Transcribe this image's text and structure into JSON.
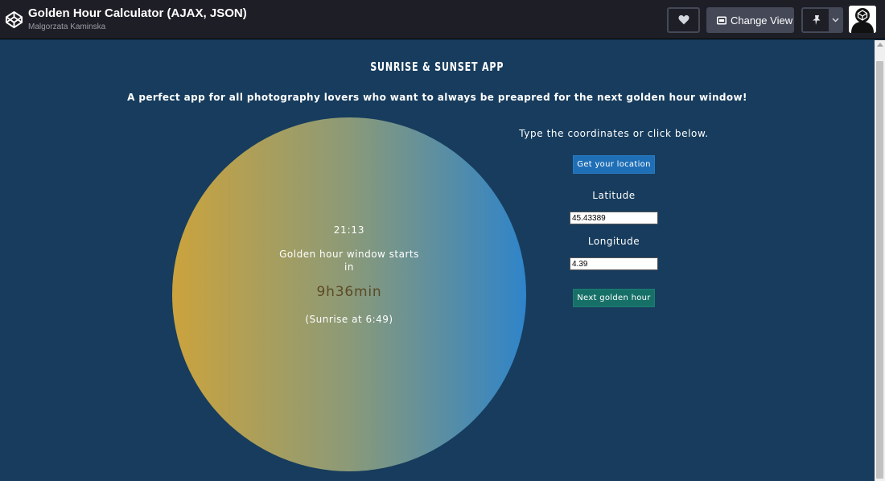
{
  "header": {
    "title": "Golden Hour Calculator (AJAX, JSON)",
    "author": "Malgorzata Kaminska",
    "change_view_label": "Change View"
  },
  "app": {
    "heading": "SUNRISE & SUNSET APP",
    "tagline": "A perfect app for all photography lovers who want to always be preapred for the next golden hour window!",
    "circle": {
      "time": "21:13",
      "label": "Golden hour window starts in",
      "countdown": "9h36min",
      "sunrise": "(Sunrise at 6:49)"
    },
    "form": {
      "instructions": "Type the coordinates or click below.",
      "location_button": "Get your location",
      "latitude_label": "Latitude",
      "latitude_value": "45.43389",
      "longitude_label": "Longitude",
      "longitude_value": "4.39",
      "next_button": "Next golden hour"
    }
  },
  "colors": {
    "background": "#173c5d",
    "gradient_start": "#cba33d",
    "gradient_end": "#2f84c9",
    "location_button": "#1f6fb7",
    "next_button": "#177067"
  },
  "icons": [
    "codepen-logo-icon",
    "heart-icon",
    "change-view-icon",
    "pin-icon",
    "chevron-down-icon",
    "user-avatar"
  ]
}
